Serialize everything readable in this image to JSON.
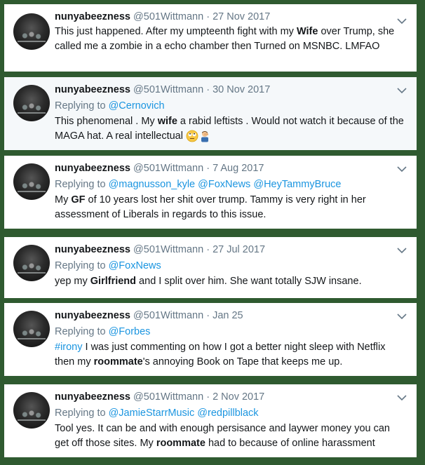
{
  "tweets": [
    {
      "name": "nunyabeezness",
      "handle": "@501Wittmann",
      "date": "27 Nov 2017",
      "replying_label": "",
      "replying_to": [],
      "text_parts": [
        {
          "t": "This just happened. After my umpteenth fight with my ",
          "bold": false
        },
        {
          "t": "Wife",
          "bold": true
        },
        {
          "t": " over Trump, she called me a zombie in a echo chamber then Turned on MSNBC. LMFAO",
          "bold": false
        }
      ]
    },
    {
      "name": "nunyabeezness",
      "handle": "@501Wittmann",
      "date": "30 Nov 2017",
      "replying_label": "Replying to",
      "replying_to": [
        "@Cernovich"
      ],
      "text_parts": [
        {
          "t": "This phenomenal . My ",
          "bold": false
        },
        {
          "t": "wife",
          "bold": true
        },
        {
          "t": " a rabid leftists . Would not watch it because of the MAGA hat.  A real intellectual ",
          "bold": false
        }
      ],
      "emojis": [
        "rolling-eyes-emoji",
        "man-facepalming-emoji"
      ]
    },
    {
      "name": "nunyabeezness",
      "handle": "@501Wittmann",
      "date": "7 Aug 2017",
      "replying_label": "Replying to",
      "replying_to": [
        "@magnusson_kyle",
        "@FoxNews",
        "@HeyTammyBruce"
      ],
      "text_parts": [
        {
          "t": "My ",
          "bold": false
        },
        {
          "t": "GF",
          "bold": true
        },
        {
          "t": " of 10 years lost her shit over trump.  Tammy is very right in her assessment of Liberals in regards to this issue.",
          "bold": false
        }
      ]
    },
    {
      "name": "nunyabeezness",
      "handle": "@501Wittmann",
      "date": "27 Jul 2017",
      "replying_label": "Replying to",
      "replying_to": [
        "@FoxNews"
      ],
      "text_parts": [
        {
          "t": "yep my ",
          "bold": false
        },
        {
          "t": "Girlfriend",
          "bold": true
        },
        {
          "t": " and I split over him.  She want totally SJW insane.",
          "bold": false
        }
      ]
    },
    {
      "name": "nunyabeezness",
      "handle": "@501Wittmann",
      "date": "Jan 25",
      "replying_label": "Replying to",
      "replying_to": [
        "@Forbes"
      ],
      "text_parts": [
        {
          "t": "#irony",
          "bold": false,
          "link": true
        },
        {
          "t": " I was just commenting on how I got a better night sleep with Netflix then my ",
          "bold": false
        },
        {
          "t": "roommate",
          "bold": true
        },
        {
          "t": "'s annoying Book on Tape that keeps me up.",
          "bold": false
        }
      ]
    },
    {
      "name": "nunyabeezness",
      "handle": "@501Wittmann",
      "date": "2 Nov 2017",
      "replying_label": "Replying to",
      "replying_to": [
        "@JamieStarrMusic",
        "@redpillblack"
      ],
      "text_parts": [
        {
          "t": "Tool yes. It can be and with enough persisance and laywer money you can get off those sites. My ",
          "bold": false
        },
        {
          "t": "roommate",
          "bold": true
        },
        {
          "t": " had to because of online harassment",
          "bold": false
        }
      ]
    }
  ],
  "colors": {
    "background": "#2f5a30",
    "link": "#1b95e0",
    "meta": "#657786",
    "text": "#14171a"
  }
}
